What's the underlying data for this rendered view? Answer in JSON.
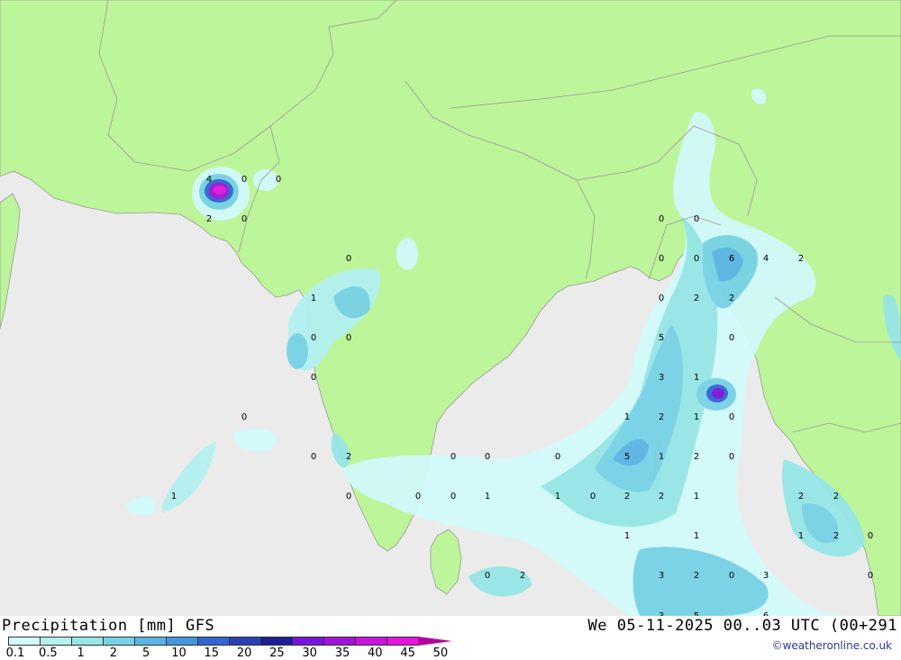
{
  "header": {
    "title": "Precipitation [mm] GFS",
    "datetime": "We 05-11-2025 00..03 UTC (00+291",
    "credit": "©weatheronline.co.uk"
  },
  "legend": {
    "ticks": [
      "0.1",
      "0.5",
      "1",
      "2",
      "5",
      "10",
      "15",
      "20",
      "25",
      "30",
      "35",
      "40",
      "45",
      "50"
    ],
    "colors": [
      "#d2fafa",
      "#b4f0f0",
      "#96e6e6",
      "#78d2e6",
      "#5ab4e6",
      "#4696dc",
      "#3264d2",
      "#2840b4",
      "#1e1e96",
      "#7814dc",
      "#a014dc",
      "#c814dc",
      "#e614dc",
      "#b40096"
    ]
  },
  "map_colors": {
    "land": "#bdf59a",
    "sea": "#ebebeb",
    "border": "#9a9a9a"
  },
  "map_values": {
    "labels": [
      "4",
      "0",
      "0",
      "2",
      "0",
      "0",
      "1",
      "0",
      "0",
      "0",
      "0",
      "2",
      "0",
      "1",
      "0",
      "0",
      "0",
      "0",
      "0",
      "1",
      "1",
      "0",
      "2",
      "2",
      "0",
      "0",
      "6",
      "4",
      "2",
      "0",
      "2",
      "2",
      "5",
      "0",
      "3",
      "1",
      "1",
      "2",
      "1",
      "0",
      "5",
      "1",
      "2",
      "0",
      "0",
      "2",
      "2",
      "1",
      "1",
      "1",
      "2",
      "1",
      "0",
      "2",
      "0",
      "3",
      "2",
      "0",
      "3",
      "0",
      "0",
      "3",
      "5",
      "6",
      "0"
    ]
  }
}
